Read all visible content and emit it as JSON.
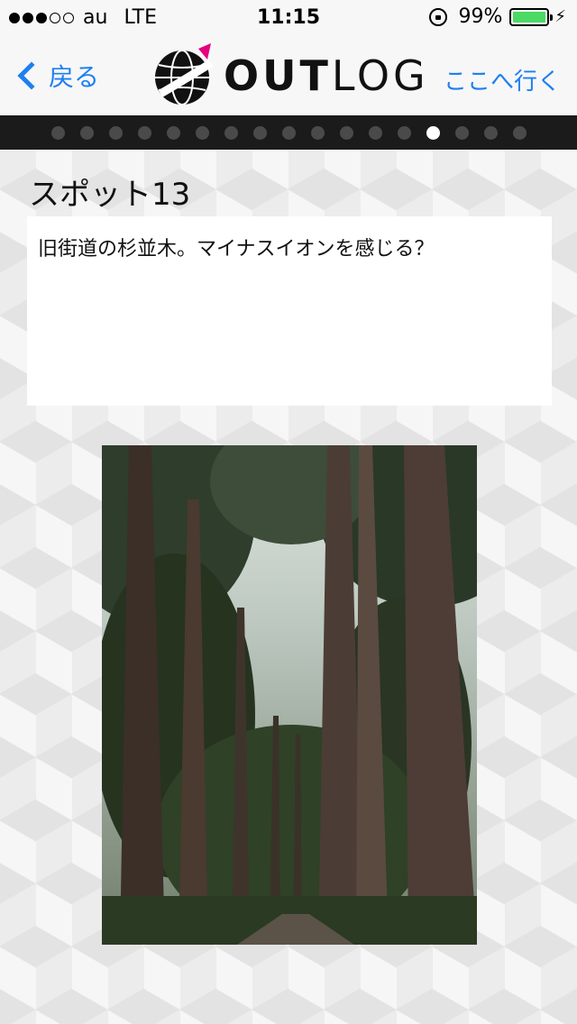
{
  "status_bar": {
    "carrier": "au",
    "network": "LTE",
    "time": "11:15",
    "battery_percent": "99%",
    "signal_bars_filled": 3,
    "signal_bars_total": 5
  },
  "nav": {
    "back_label": "戻る",
    "logo_text_bold": "OUT",
    "logo_text_thin": "LOG",
    "go_label": "ここへ行く"
  },
  "pager": {
    "total": 17,
    "current_index": 13
  },
  "spot": {
    "title": "スポット13",
    "description": "旧街道の杉並木。マイナスイオンを感じる？"
  },
  "colors": {
    "accent": "#1f7ff0",
    "battery": "#4cd964",
    "logo_accent": "#e4007f"
  }
}
